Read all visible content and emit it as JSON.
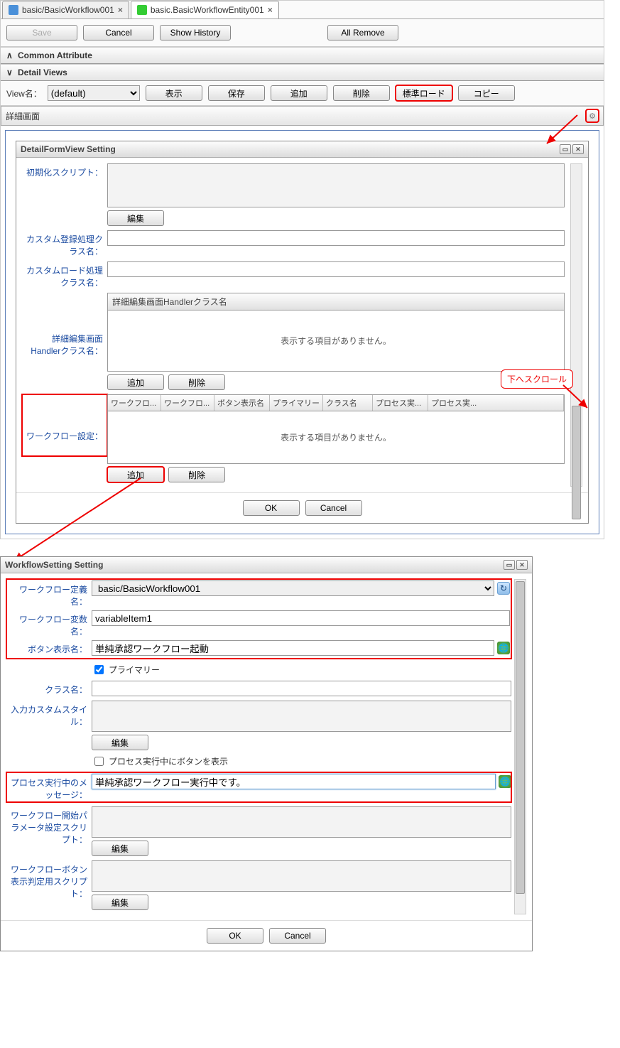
{
  "tabs": [
    {
      "label": "basic/BasicWorkflow001",
      "active": false
    },
    {
      "label": "basic.BasicWorkflowEntity001",
      "active": true
    }
  ],
  "toolbar": {
    "save": "Save",
    "cancel": "Cancel",
    "show_history": "Show History",
    "all_remove": "All Remove"
  },
  "accordions": {
    "common_attribute": "Common Attribute",
    "detail_views": "Detail Views"
  },
  "view_row": {
    "label": "View名：",
    "selected": "(default)",
    "buttons": {
      "display": "表示",
      "save": "保存",
      "add": "追加",
      "delete": "削除",
      "standard_load": "標準ロード",
      "copy": "コピー"
    }
  },
  "detail_panel_title": "詳細画面",
  "detail_form_view": {
    "title": "DetailFormView Setting",
    "labels": {
      "init_script": "初期化スクリプト：",
      "custom_register": "カスタム登録処理クラス名：",
      "custom_load": "カスタムロード処理クラス名：",
      "handler": "詳細編集画面Handlerクラス名：",
      "workflow_setting": "ワークフロー設定："
    },
    "handler_section_header": "詳細編集画面Handlerクラス名",
    "no_items": "表示する項目がありません。",
    "buttons": {
      "edit": "編集",
      "add": "追加",
      "delete": "削除"
    },
    "grid_cols": [
      "ワークフロ...",
      "ワークフロ...",
      "ボタン表示名",
      "プライマリー",
      "クラス名",
      "プロセス実...",
      "プロセス実..."
    ],
    "ok": "OK",
    "cancel": "Cancel"
  },
  "callout_scroll": "下へスクロール",
  "workflow_setting": {
    "title": "WorkflowSetting Setting",
    "labels": {
      "def_name": "ワークフロー定義名：",
      "var_name": "ワークフロー変数名：",
      "btn_disp": "ボタン表示名：",
      "primary": "プライマリー",
      "class_name": "クラス名：",
      "input_custom_style": "入力カスタムスタイル：",
      "show_btn_during_process": "プロセス実行中にボタンを表示",
      "process_running_msg": "プロセス実行中のメッセージ：",
      "start_param_script": "ワークフロー開始パラメータ設定スクリプト：",
      "btn_display_cond_script": "ワークフローボタン表示判定用スクリプト："
    },
    "values": {
      "def_name": "basic/BasicWorkflow001",
      "var_name": "variableItem1",
      "btn_disp": "単純承認ワークフロー起動",
      "primary_checked": true,
      "class_name": "",
      "show_btn_checked": false,
      "process_running_msg": "単純承認ワークフロー実行中です。"
    },
    "buttons": {
      "edit": "編集"
    },
    "ok": "OK",
    "cancel": "Cancel"
  }
}
